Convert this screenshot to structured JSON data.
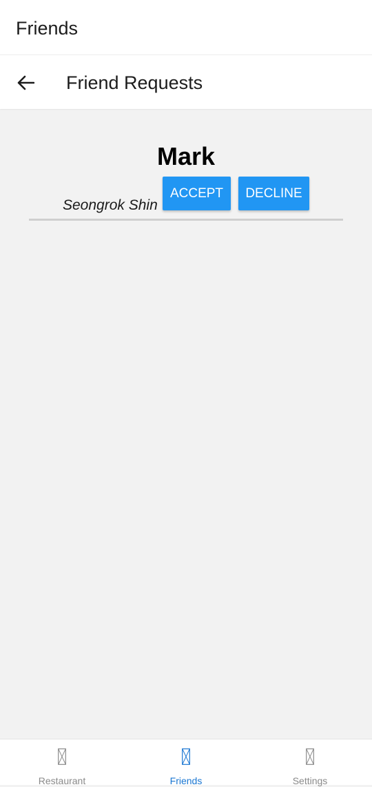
{
  "header": {
    "title": "Friends"
  },
  "subheader": {
    "title": "Friend Requests"
  },
  "request": {
    "name": "Mark",
    "subname": "Seongrok Shin",
    "accept_label": "ACCEPT",
    "decline_label": "DECLINE"
  },
  "tabs": [
    {
      "label": "Restaurant",
      "icon": "broken-image-icon",
      "active": false
    },
    {
      "label": "Friends",
      "icon": "broken-image-icon",
      "active": true
    },
    {
      "label": "Settings",
      "icon": "broken-image-icon",
      "active": false
    }
  ],
  "colors": {
    "accent": "#2196f3",
    "active_tab": "#1976d2",
    "inactive_tab": "#8a8a8a",
    "background": "#f2f2f2"
  }
}
